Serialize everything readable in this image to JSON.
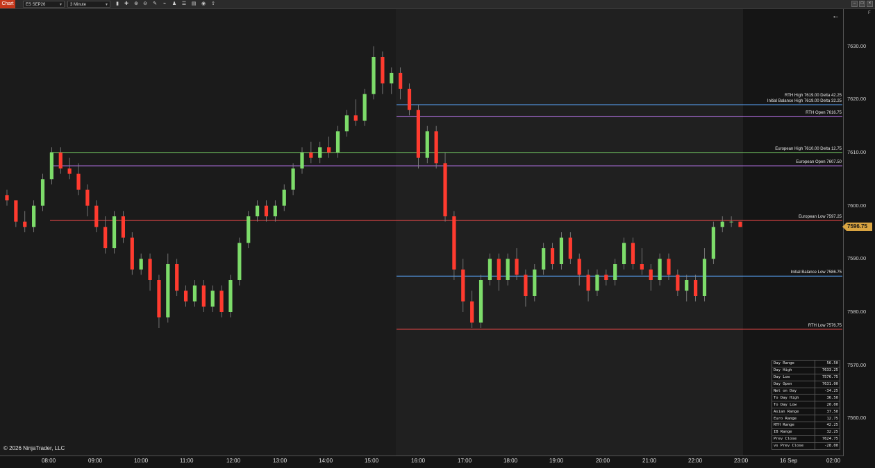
{
  "toolbar": {
    "chart_tab": "Chart",
    "instrument": "ES SEP26",
    "interval": "3 Minute",
    "icons": [
      "bars-icon",
      "crosshair-icon",
      "zoom-in-icon",
      "zoom-out-icon",
      "draw-icon",
      "indicators-icon",
      "strategies-icon",
      "properties-icon",
      "templates-icon",
      "screenshot-icon",
      "share-icon"
    ]
  },
  "window_controls": [
    "minimize-icon",
    "maximize-icon",
    "close-icon"
  ],
  "price_axis": {
    "ticks": [
      "7630.00",
      "7620.00",
      "7610.00",
      "7600.00",
      "7590.00",
      "7580.00",
      "7570.00",
      "7560.00"
    ],
    "last_price": "7596.75",
    "marker": "F"
  },
  "time_axis": {
    "ticks": [
      "08:00",
      "09:00",
      "10:00",
      "11:00",
      "12:00",
      "13:00",
      "14:00",
      "15:00",
      "16:00",
      "17:00",
      "18:00",
      "19:00",
      "20:00",
      "21:00",
      "22:00",
      "23:00",
      "16 Sep",
      "02:00"
    ]
  },
  "levels": [
    {
      "label": "RTH High 7619.00   Delta 42.25",
      "price": 7619.0,
      "color": "#5aa8ff",
      "start": "15:30"
    },
    {
      "label": "Initial Balance High 7619.00   Delta 32.25",
      "price": 7619.0,
      "color": "#5aa8ff",
      "start": "15:30"
    },
    {
      "label": "RTH Open 7616.75",
      "price": 7616.75,
      "color": "#c77dff",
      "start": "15:30"
    },
    {
      "label": "European High 7610.00   Delta 12.75",
      "price": 7610.0,
      "color": "#7ddc6a",
      "start": "08:00"
    },
    {
      "label": "European Open 7607.50",
      "price": 7607.5,
      "color": "#c77dff",
      "start": "08:00"
    },
    {
      "label": "European Low 7597.25",
      "price": 7597.25,
      "color": "#ff4d4d",
      "start": "08:00"
    },
    {
      "label": "Initial Balance Low 7586.75",
      "price": 7586.75,
      "color": "#5aa8ff",
      "start": "15:30"
    },
    {
      "label": "RTH Low 7576.75",
      "price": 7576.75,
      "color": "#ff4d4d",
      "start": "15:30"
    }
  ],
  "stats": [
    [
      "Day Range",
      "56.50"
    ],
    [
      "Day High",
      "7633.25"
    ],
    [
      "Day Low",
      "7576.75"
    ],
    [
      "Day Open",
      "7631.00"
    ],
    [
      "Net on Day",
      "-34.25"
    ],
    [
      "To Day High",
      "36.50"
    ],
    [
      "To Day Low",
      "20.00"
    ],
    [
      "Asian Range",
      "37.50"
    ],
    [
      "Euro Range",
      "12.75"
    ],
    [
      "RTH Range",
      "42.25"
    ],
    [
      "IB Range",
      "32.25"
    ],
    [
      "Prev Close",
      "7624.75"
    ],
    [
      "vs Prev Close",
      "-28.00"
    ]
  ],
  "copyright": "© 2026 NinjaTrader, LLC",
  "colors": {
    "up": "#7ddc6a",
    "down": "#ff3b2f",
    "last_price": "#d9a441"
  },
  "chart_data": {
    "type": "candlestick",
    "candles": [
      [
        7602,
        7603,
        7600,
        7601
      ],
      [
        7601,
        7601,
        7596,
        7597
      ],
      [
        7597,
        7599,
        7595,
        7596
      ],
      [
        7596,
        7601,
        7595,
        7600
      ],
      [
        7600,
        7606,
        7599,
        7605
      ],
      [
        7605,
        7611,
        7604,
        7610
      ],
      [
        7610,
        7611,
        7606,
        7607
      ],
      [
        7607,
        7609,
        7605,
        7606
      ],
      [
        7606,
        7608,
        7602,
        7603
      ],
      [
        7603,
        7604,
        7598,
        7600
      ],
      [
        7600,
        7601,
        7595,
        7596
      ],
      [
        7596,
        7598,
        7591,
        7592
      ],
      [
        7592,
        7599,
        7591,
        7598
      ],
      [
        7598,
        7599,
        7593,
        7594
      ],
      [
        7594,
        7595,
        7587,
        7588
      ],
      [
        7588,
        7591,
        7587,
        7590
      ],
      [
        7590,
        7591,
        7584,
        7586
      ],
      [
        7586,
        7587,
        7577,
        7579
      ],
      [
        7579,
        7591,
        7578,
        7589
      ],
      [
        7589,
        7590,
        7583,
        7584
      ],
      [
        7584,
        7585,
        7581,
        7582
      ],
      [
        7582,
        7586,
        7581,
        7585
      ],
      [
        7585,
        7586,
        7580,
        7581
      ],
      [
        7581,
        7585,
        7580,
        7584
      ],
      [
        7584,
        7585,
        7579,
        7580
      ],
      [
        7580,
        7587,
        7579,
        7586
      ],
      [
        7586,
        7594,
        7585,
        7593
      ],
      [
        7593,
        7599,
        7592,
        7598
      ],
      [
        7598,
        7601,
        7597,
        7600
      ],
      [
        7600,
        7601,
        7597,
        7598
      ],
      [
        7598,
        7601,
        7597,
        7600
      ],
      [
        7600,
        7604,
        7599,
        7603
      ],
      [
        7603,
        7608,
        7602,
        7607
      ],
      [
        7607,
        7611,
        7606,
        7610
      ],
      [
        7610,
        7612,
        7608,
        7609
      ],
      [
        7609,
        7612,
        7608,
        7611
      ],
      [
        7611,
        7613,
        7609,
        7610
      ],
      [
        7610,
        7615,
        7609,
        7614
      ],
      [
        7614,
        7618,
        7613,
        7617
      ],
      [
        7617,
        7620,
        7615,
        7616
      ],
      [
        7616,
        7622,
        7615,
        7621
      ],
      [
        7621,
        7630,
        7620,
        7628
      ],
      [
        7628,
        7629,
        7621,
        7623
      ],
      [
        7623,
        7626,
        7621,
        7625
      ],
      [
        7625,
        7626,
        7620,
        7622
      ],
      [
        7622,
        7623,
        7617,
        7618
      ],
      [
        7618,
        7619,
        7607,
        7609
      ],
      [
        7609,
        7615,
        7608,
        7614
      ],
      [
        7614,
        7615,
        7607,
        7608
      ],
      [
        7608,
        7610,
        7597,
        7598
      ],
      [
        7598,
        7599,
        7586,
        7588
      ],
      [
        7588,
        7590,
        7580,
        7582
      ],
      [
        7582,
        7584,
        7577,
        7578
      ],
      [
        7578,
        7587,
        7577,
        7586
      ],
      [
        7586,
        7591,
        7585,
        7590
      ],
      [
        7590,
        7591,
        7584,
        7586
      ],
      [
        7586,
        7591,
        7585,
        7590
      ],
      [
        7590,
        7592,
        7586,
        7587
      ],
      [
        7587,
        7588,
        7581,
        7583
      ],
      [
        7583,
        7589,
        7582,
        7588
      ],
      [
        7588,
        7593,
        7587,
        7592
      ],
      [
        7592,
        7593,
        7588,
        7589
      ],
      [
        7589,
        7595,
        7588,
        7594
      ],
      [
        7594,
        7595,
        7589,
        7590
      ],
      [
        7590,
        7591,
        7585,
        7587
      ],
      [
        7587,
        7588,
        7582,
        7584
      ],
      [
        7584,
        7588,
        7583,
        7587
      ],
      [
        7587,
        7588,
        7585,
        7586
      ],
      [
        7586,
        7590,
        7585,
        7589
      ],
      [
        7589,
        7594,
        7588,
        7593
      ],
      [
        7593,
        7594,
        7588,
        7589
      ],
      [
        7589,
        7592,
        7587,
        7588
      ],
      [
        7588,
        7589,
        7584,
        7586
      ],
      [
        7586,
        7591,
        7585,
        7590
      ],
      [
        7590,
        7591,
        7586,
        7587
      ],
      [
        7587,
        7588,
        7583,
        7584
      ],
      [
        7584,
        7587,
        7582,
        7586
      ],
      [
        7586,
        7587,
        7582,
        7583
      ],
      [
        7583,
        7592,
        7582,
        7590
      ],
      [
        7590,
        7597,
        7589,
        7596
      ],
      [
        7596,
        7598,
        7595,
        7597
      ],
      [
        7597,
        7598,
        7596,
        7597
      ],
      [
        7597,
        7597,
        7596,
        7596
      ]
    ],
    "ylim": [
      7553,
      7637
    ]
  }
}
